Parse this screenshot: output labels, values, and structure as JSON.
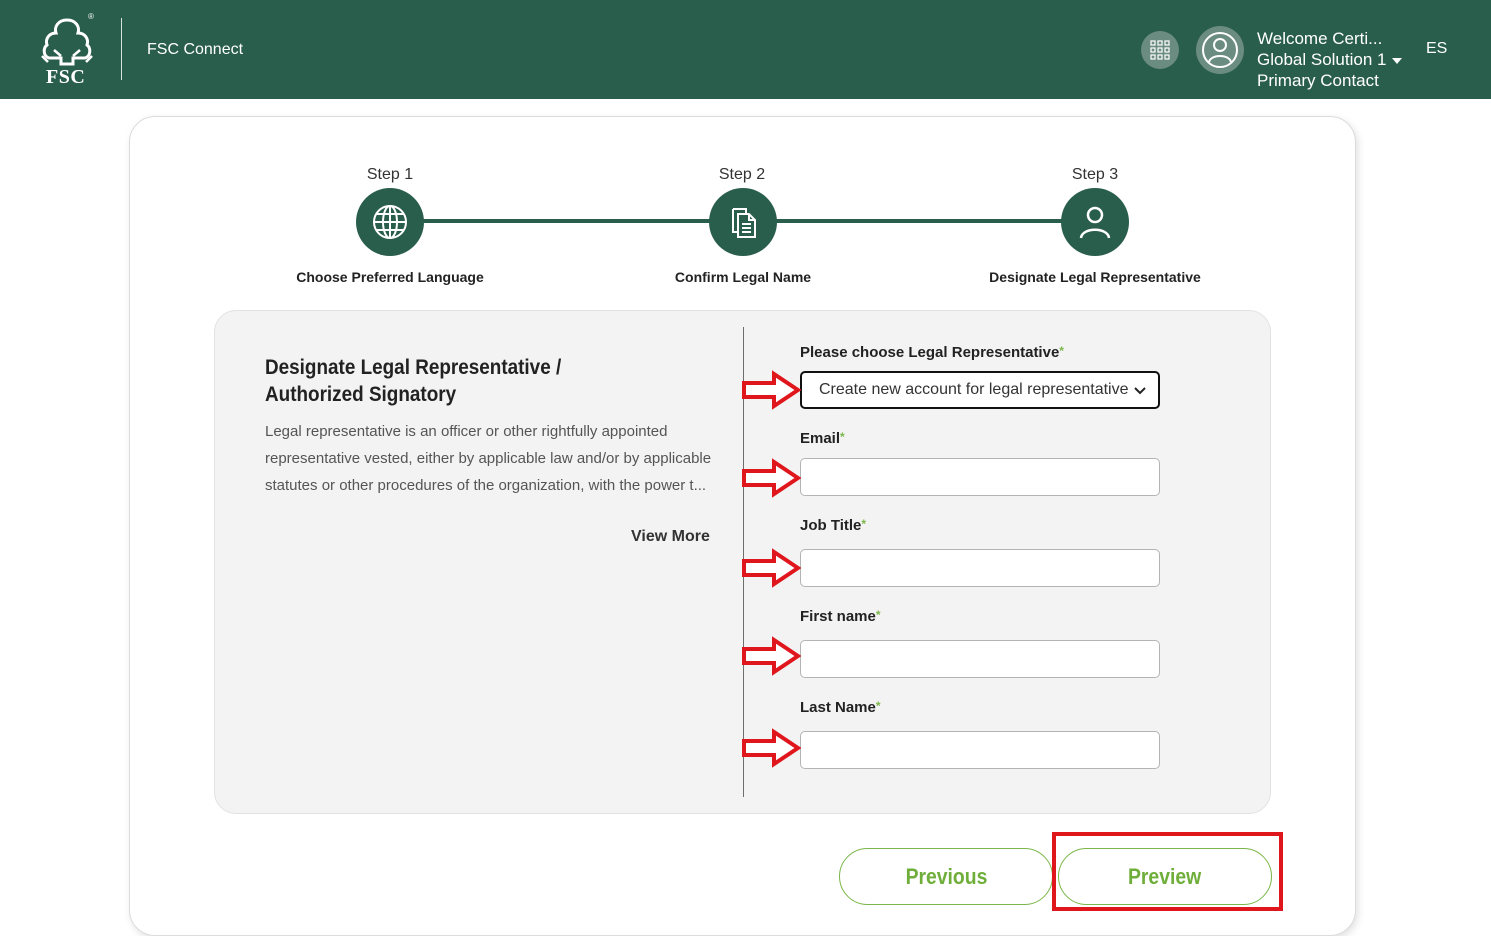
{
  "header": {
    "logo_text": "FSC",
    "logo_reg": "®",
    "app_name": "FSC Connect",
    "apps_icon": "grid-icon",
    "avatar_icon": "user-avatar-icon",
    "user_welcome": "Welcome Certi...",
    "user_org": "Global Solution 1",
    "user_role": "Primary Contact",
    "language": "ES"
  },
  "steps": [
    {
      "top_label": "Step 1",
      "title": "Choose Preferred Language",
      "icon": "globe-icon"
    },
    {
      "top_label": "Step 2",
      "title": "Confirm Legal Name",
      "icon": "document-icon"
    },
    {
      "top_label": "Step 3",
      "title": "Designate Legal Representative",
      "icon": "person-icon"
    }
  ],
  "section": {
    "title": "Designate Legal Representative / Authorized Signatory",
    "description": "Legal representative is an officer or other rightfully appointed representative vested, either by applicable law and/or by applicable statutes or other procedures of the organization, with the power t...",
    "view_more": "View More"
  },
  "form": {
    "representative_label": "Please choose Legal Representative",
    "representative_value": "Create new account for legal representative",
    "email_label": "Email",
    "email_value": "",
    "job_title_label": "Job Title",
    "job_title_value": "",
    "first_name_label": "First name",
    "first_name_value": "",
    "last_name_label": "Last Name",
    "last_name_value": "",
    "required_mark": "*"
  },
  "buttons": {
    "previous": "Previous",
    "preview": "Preview"
  },
  "colors": {
    "header_bg": "#2a5e4c",
    "accent_green": "#7ab648",
    "annotation_red": "#e0161d"
  }
}
